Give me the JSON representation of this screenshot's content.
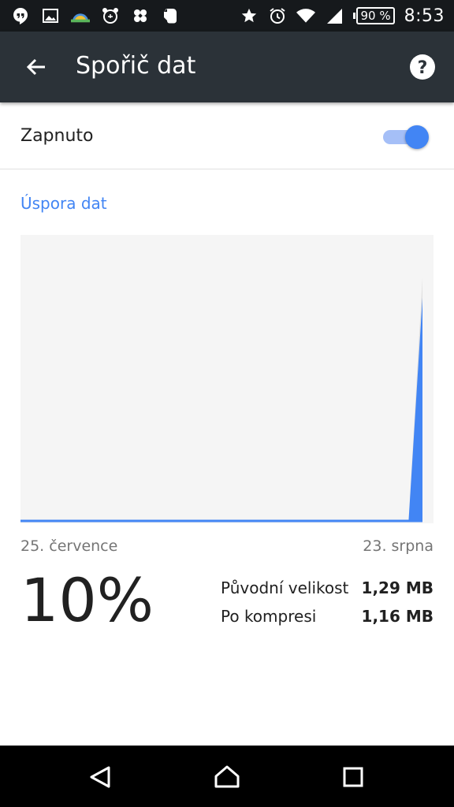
{
  "status_bar": {
    "battery": "90 %",
    "time": "8:53",
    "left_icons": [
      "hangouts-icon",
      "gallery-icon",
      "weather-icon",
      "alarm-app-icon",
      "clover-icon",
      "evernote-icon"
    ],
    "right_icons": [
      "star-icon",
      "alarm-icon",
      "wifi-icon",
      "signal-icon",
      "battery-icon"
    ]
  },
  "toolbar": {
    "title": "Spořič dat"
  },
  "toggle": {
    "label": "Zapnuto",
    "checked": true
  },
  "section": {
    "header": "Úspora dat"
  },
  "chart_data": {
    "type": "area",
    "x_labels": [
      "25. července",
      "23. srpna"
    ],
    "series": [
      {
        "color": "#e0e0e0",
        "values": [
          0,
          0,
          0,
          0,
          0,
          0,
          0,
          0,
          0,
          0,
          0,
          0,
          0,
          0,
          0,
          0,
          0,
          0,
          0,
          0,
          0,
          0,
          0,
          0,
          0,
          0,
          0,
          0,
          0,
          0.85
        ]
      },
      {
        "color": "#4285f4",
        "values": [
          0,
          0,
          0,
          0,
          0,
          0,
          0,
          0,
          0,
          0,
          0,
          0,
          0,
          0,
          0,
          0,
          0,
          0,
          0,
          0,
          0,
          0,
          0,
          0,
          0,
          0,
          0,
          0,
          0,
          0.78
        ]
      }
    ],
    "colors": {
      "background": "#f5f5f5",
      "baseline": "#4285f4"
    }
  },
  "stats": {
    "percent": "10%",
    "rows": [
      {
        "label": "Původní velikost",
        "value": "1,29 MB"
      },
      {
        "label": "Po kompresi",
        "value": "1,16 MB"
      }
    ]
  },
  "colors": {
    "accent": "#4285f4",
    "toolbar": "#2b3238",
    "statusbar": "#16191c"
  }
}
